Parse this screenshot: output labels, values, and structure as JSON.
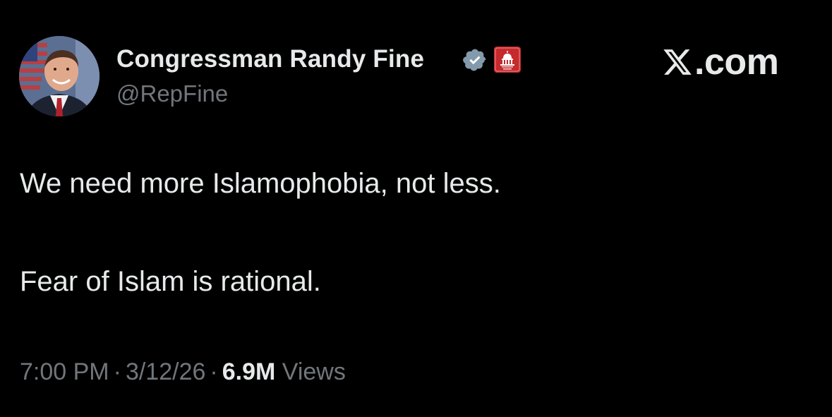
{
  "author": {
    "display_name": "Congressman Randy Fine",
    "handle": "@RepFine",
    "avatar_icon": "portrait-avatar",
    "verified_icon": "verified-badge-icon",
    "affiliation_icon": "us-capitol-gov-badge-icon"
  },
  "brand": {
    "logo_text": ".com",
    "logo_icon": "x-logo-icon"
  },
  "tweet": {
    "line1": "We need more Islamophobia, not less.",
    "line2": "Fear of Islam is rational."
  },
  "meta": {
    "time": "7:00 PM",
    "separator": "·",
    "date": "3/12/26",
    "views_count": "6.9M",
    "views_label": "Views"
  },
  "colors": {
    "background": "#000000",
    "primary_text": "#e7e9ea",
    "secondary_text": "#71767b",
    "verified_badge": "#829aab",
    "gov_badge": "#c52a2d"
  }
}
